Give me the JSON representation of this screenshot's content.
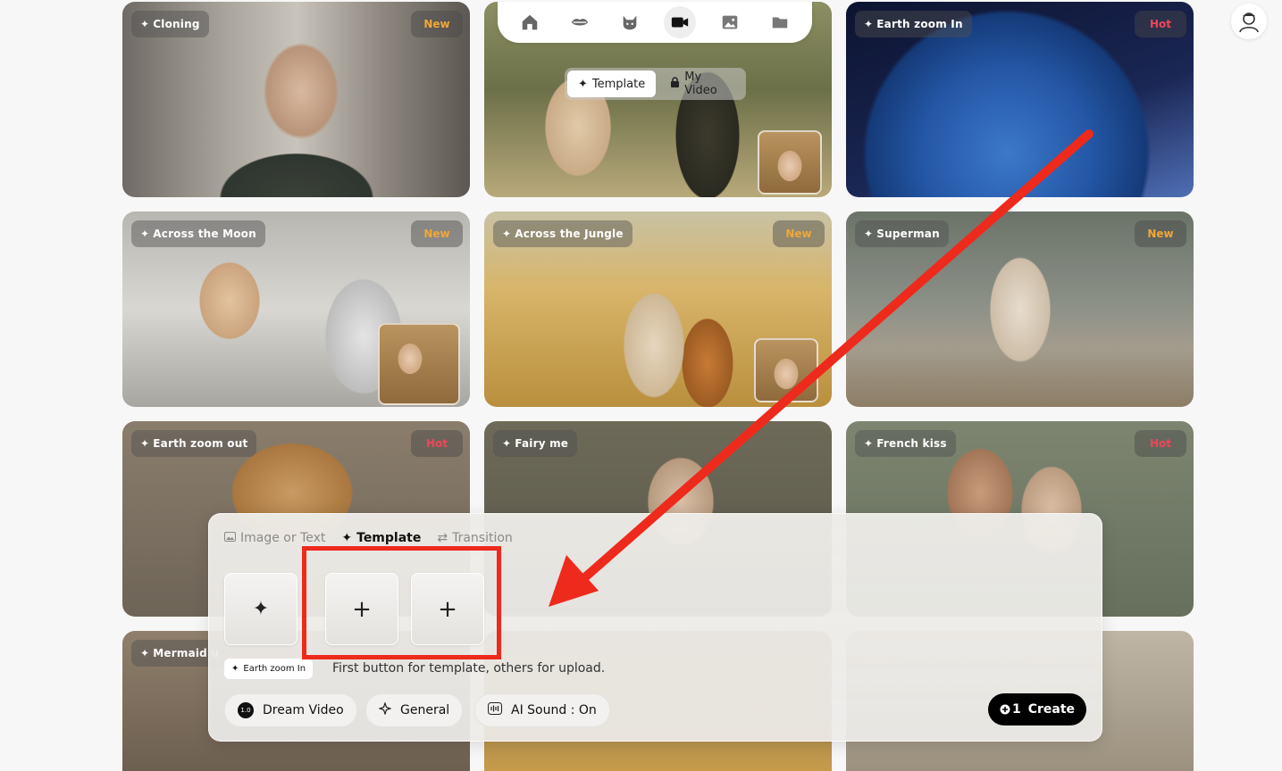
{
  "nav": {
    "icons": [
      "home-icon",
      "lips-icon",
      "cat-icon",
      "video-camera-icon",
      "image-icon",
      "folder-icon"
    ],
    "active": "video-camera-icon"
  },
  "segment": {
    "template_label": "Template",
    "myvideo_label": "My Video"
  },
  "cards": [
    {
      "title": "Cloning",
      "badge": "New"
    },
    {
      "title": "",
      "badge": ""
    },
    {
      "title": "Earth zoom In",
      "badge": "Hot"
    },
    {
      "title": "Across the Moon",
      "badge": "New"
    },
    {
      "title": "Across the Jungle",
      "badge": "New"
    },
    {
      "title": "Superman",
      "badge": "New"
    },
    {
      "title": "Earth zoom out",
      "badge": "Hot"
    },
    {
      "title": "Fairy me",
      "badge": ""
    },
    {
      "title": "French kiss",
      "badge": "Hot"
    },
    {
      "title": "Mermaid u",
      "badge": ""
    }
  ],
  "composer": {
    "tabs": [
      {
        "label": "Image or Text"
      },
      {
        "label": "Template"
      },
      {
        "label": "Transition"
      }
    ],
    "selected_template": "Earth zoom In",
    "hint": "First button for template, others for upload.",
    "model_badge": "1.0",
    "model_label": "Dream Video",
    "style_label": "General",
    "sound_label": "AI Sound : On",
    "create_label": "Create",
    "create_cost": "1"
  },
  "colors": {
    "accent_new": "#f0a73a",
    "accent_hot": "#f0455a",
    "annotation": "#ee2a1c"
  }
}
